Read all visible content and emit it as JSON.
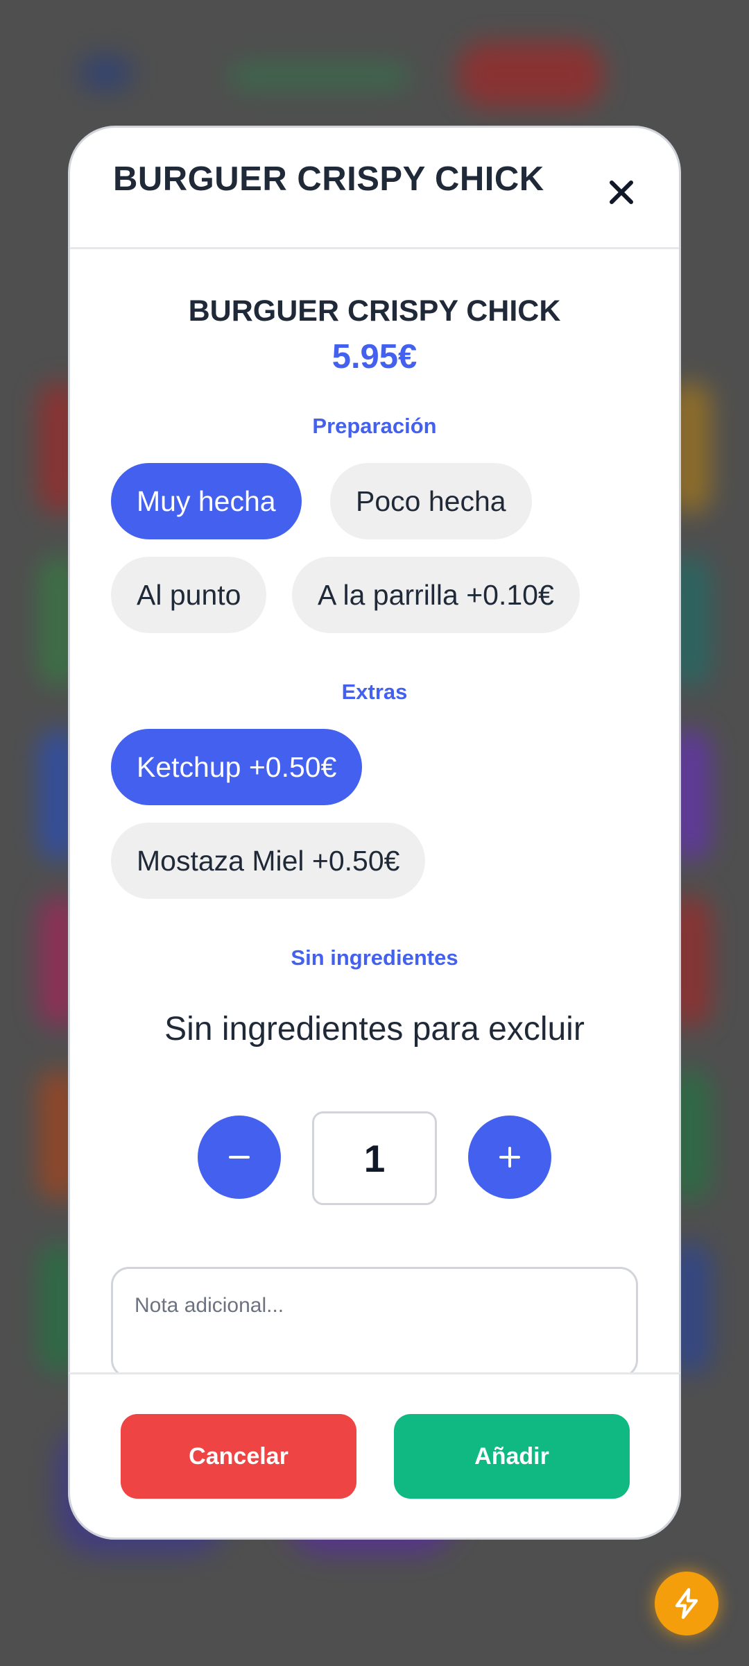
{
  "modal": {
    "title": "BURGUER CRISPY CHICK",
    "close_icon": "close-icon"
  },
  "product": {
    "name": "BURGUER CRISPY CHICK",
    "price": "5.95€"
  },
  "preparation": {
    "label": "Preparación",
    "options": [
      {
        "label": "Muy hecha",
        "selected": true
      },
      {
        "label": "Poco hecha",
        "selected": false
      },
      {
        "label": "Al punto",
        "selected": false
      },
      {
        "label": "A la parrilla +0.10€",
        "selected": false
      }
    ]
  },
  "extras": {
    "label": "Extras",
    "options": [
      {
        "label": "Ketchup +0.50€",
        "selected": true
      },
      {
        "label": "Mostaza Miel +0.50€",
        "selected": false
      }
    ]
  },
  "exclusions": {
    "label": "Sin ingredientes",
    "empty_text": "Sin ingredientes para excluir"
  },
  "quantity": {
    "value": "1",
    "decrement_icon": "minus-icon",
    "increment_icon": "plus-icon"
  },
  "note": {
    "placeholder": "Nota adicional..."
  },
  "footer": {
    "cancel_label": "Cancelar",
    "add_label": "Añadir"
  },
  "fab": {
    "icon": "lightning-icon"
  },
  "colors": {
    "accent": "#4361ee",
    "cancel": "#ef4444",
    "confirm": "#10b981",
    "fab": "#f59e0b"
  }
}
